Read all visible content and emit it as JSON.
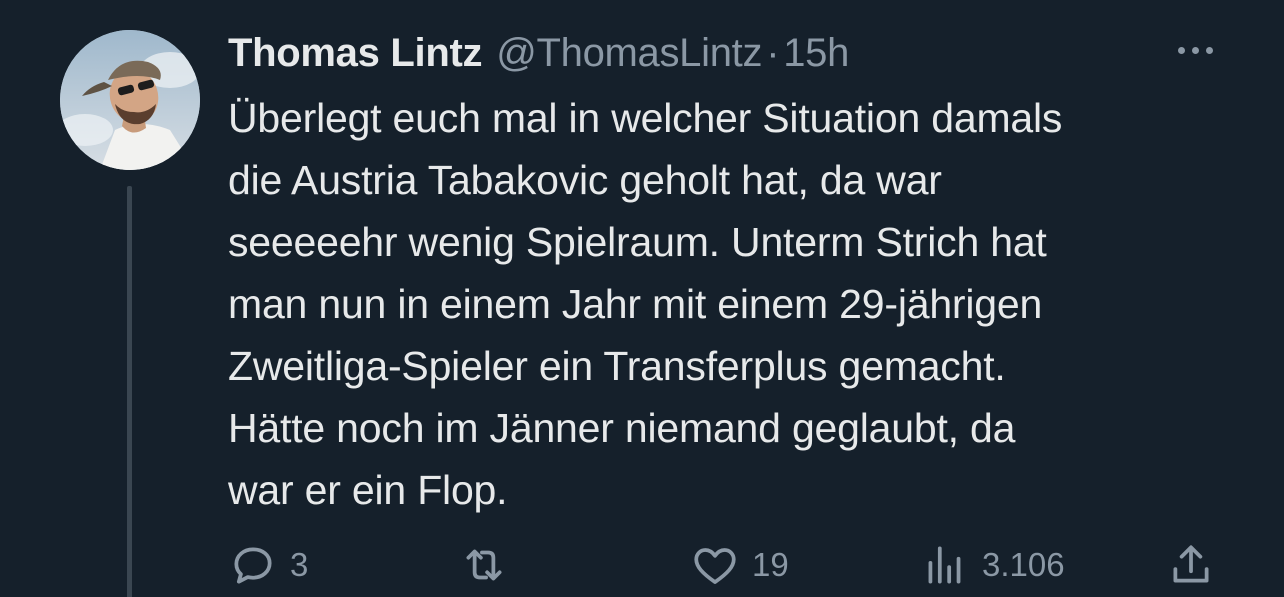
{
  "tweet": {
    "display_name": "Thomas Lintz",
    "handle": "@ThomasLintz",
    "separator": "·",
    "time": "15h",
    "text_lines": [
      "Überlegt euch mal in welcher Situation damals",
      "die Austria Tabakovic geholt hat, da war",
      "seeeeehr wenig Spielraum. Unterm Strich hat",
      "man nun in einem Jahr mit einem 29-jährigen",
      "Zweitliga-Spieler ein Transferplus gemacht.",
      "Hätte noch im Jänner niemand geglaubt, da",
      "war er ein Flop."
    ]
  },
  "actions": {
    "reply_count": "3",
    "retweet_count": "",
    "like_count": "19",
    "views_count": "3.106"
  },
  "icons": {
    "more": "more-horizontal-icon",
    "reply": "reply-icon",
    "retweet": "retweet-icon",
    "like": "heart-icon",
    "views": "analytics-icon",
    "share": "share-icon"
  },
  "colors": {
    "background": "#15202b",
    "text_primary": "#e7e9ea",
    "text_secondary": "#8b98a5",
    "thread_line": "#3a4651"
  }
}
